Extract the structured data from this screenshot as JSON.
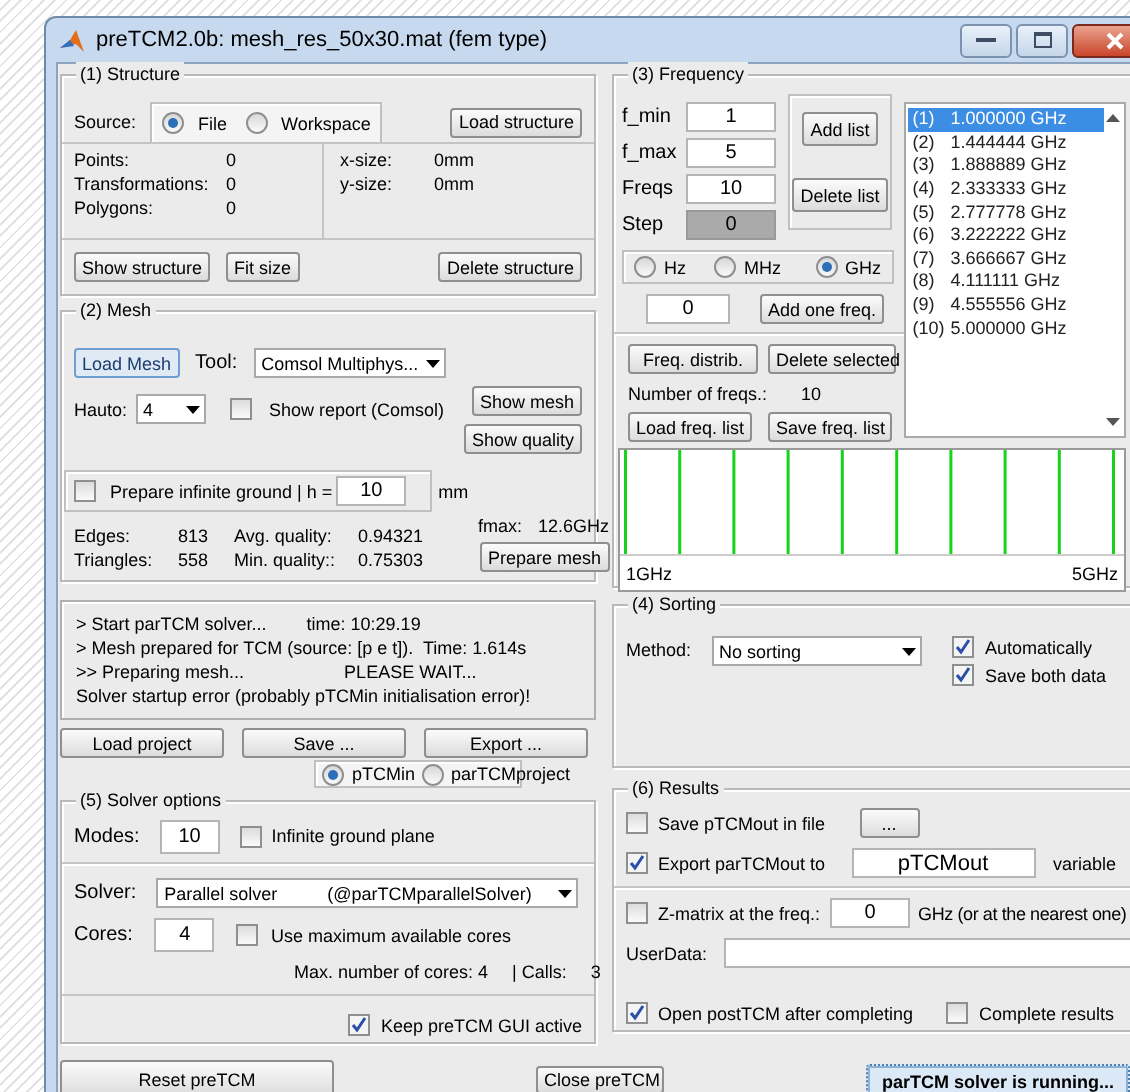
{
  "window": {
    "title": "preTCM2.0b:  mesh_res_50x30.mat (fem type)"
  },
  "structure": {
    "title": "(1) Structure",
    "source_label": "Source:",
    "source_options": [
      {
        "label": "File",
        "selected": true
      },
      {
        "label": "Workspace",
        "selected": false
      }
    ],
    "load_button": "Load structure",
    "stats": [
      {
        "label": "Points:",
        "value": "0"
      },
      {
        "label": "Transformations:",
        "value": "0"
      },
      {
        "label": "Polygons:",
        "value": "0"
      }
    ],
    "sizes": [
      {
        "label": "x-size:",
        "value": "0mm"
      },
      {
        "label": "y-size:",
        "value": "0mm"
      }
    ],
    "buttons": [
      "Show structure",
      "Fit size",
      "Delete structure"
    ]
  },
  "mesh": {
    "title": "(2) Mesh",
    "load_button": "Load Mesh",
    "tool_label": "Tool:",
    "tool_value": "Comsol Multiphys...",
    "hauto_label": "Hauto:",
    "hauto_value": "4",
    "show_report": {
      "label": "Show report (Comsol)",
      "checked": false
    },
    "show_mesh_button": "Show mesh",
    "show_quality_button": "Show quality",
    "infinite_ground": {
      "label": "Prepare infinite ground  | h =",
      "checked": false,
      "value": "10",
      "unit": "mm"
    },
    "fmax_label": "fmax:",
    "fmax_value": "12.6GHz",
    "stats": [
      {
        "label": "Edges:",
        "value": "813",
        "quality_label": "Avg. quality:",
        "quality_value": "0.94321"
      },
      {
        "label": "Triangles:",
        "value": "558",
        "quality_label": "Min. quality::",
        "quality_value": "0.75303"
      }
    ],
    "prepare_button": "Prepare mesh"
  },
  "log": [
    "> Start parTCM solver...        time: 10:29.19",
    "> Mesh prepared for TCM (source: [p e t]).  Time: 1.614s",
    ">> Preparing mesh...                    PLEASE WAIT...",
    "Solver startup error (probably pTCMin initialisation error)!"
  ],
  "project_buttons": [
    "Load project",
    "Save ...",
    "Export ..."
  ],
  "save_format": [
    {
      "label": "pTCMin",
      "selected": true
    },
    {
      "label": "parTCMproject",
      "selected": false
    }
  ],
  "solver": {
    "title": "(5) Solver options",
    "modes_label": "Modes:",
    "modes_value": "10",
    "infinite_plane": {
      "label": "Infinite ground plane",
      "checked": false
    },
    "solver_label": "Solver:",
    "solver_value": "Parallel solver          (@parTCMparallelSolver)",
    "cores_label": "Cores:",
    "cores_value": "4",
    "max_cores": {
      "label": "Use maximum available cores",
      "checked": false
    },
    "max_info": "Max. number of cores: 4",
    "calls_label": "| Calls:",
    "calls_value": "3",
    "keep_active": {
      "label": "Keep preTCM GUI active",
      "checked": true
    }
  },
  "frequency": {
    "title": "(3) Frequency",
    "fields": [
      {
        "label": "f_min",
        "value": "1",
        "disabled": false
      },
      {
        "label": "f_max",
        "value": "5",
        "disabled": false
      },
      {
        "label": "Freqs",
        "value": "10",
        "disabled": false
      },
      {
        "label": "Step",
        "value": "0",
        "disabled": true
      }
    ],
    "add_list_button": "Add list",
    "delete_list_button": "Delete list",
    "units": [
      {
        "label": "Hz",
        "selected": false
      },
      {
        "label": "MHz",
        "selected": false
      },
      {
        "label": "GHz",
        "selected": true
      }
    ],
    "one_freq_value": "0",
    "add_one_button": "Add one freq.",
    "distrib_button": "Freq. distrib.",
    "delete_selected_button": "Delete selected",
    "count_label": "Number of freqs.:",
    "count_value": "10",
    "load_list_button": "Load freq. list",
    "save_list_button": "Save freq. list",
    "list": [
      {
        "index": "(1)",
        "value": "1.000000 GHz",
        "selected": true
      },
      {
        "index": "(2)",
        "value": "1.444444 GHz",
        "selected": false
      },
      {
        "index": "(3)",
        "value": "1.888889 GHz",
        "selected": false
      },
      {
        "index": "(4)",
        "value": "2.333333 GHz",
        "selected": false
      },
      {
        "index": "(5)",
        "value": "2.777778 GHz",
        "selected": false
      },
      {
        "index": "(6)",
        "value": "3.222222 GHz",
        "selected": false
      },
      {
        "index": "(7)",
        "value": "3.666667 GHz",
        "selected": false
      },
      {
        "index": "(8)",
        "value": "4.111111 GHz",
        "selected": false
      },
      {
        "index": "(9)",
        "value": "4.555556 GHz",
        "selected": false
      },
      {
        "index": "(10)",
        "value": "5.000000 GHz",
        "selected": false
      }
    ],
    "plot_min_label": "1GHz",
    "plot_max_label": "5GHz"
  },
  "sorting": {
    "title": "(4) Sorting",
    "method_label": "Method:",
    "method_value": "No sorting",
    "options": [
      {
        "label": "Automatically",
        "checked": true
      },
      {
        "label": "Save both data",
        "checked": true
      }
    ]
  },
  "results": {
    "title": "(6) Results",
    "save_file": {
      "label": "Save pTCMout in file",
      "checked": false
    },
    "browse_button": "...",
    "export": {
      "label": "Export parTCMout to",
      "checked": true,
      "value": "pTCMout",
      "suffix": "variable"
    },
    "zmatrix": {
      "label": "Z-matrix at the freq.:",
      "checked": false,
      "value": "0",
      "suffix": "GHz (or at the nearest one)"
    },
    "userdata_label": "UserData:",
    "open_post": {
      "label": "Open postTCM after completing",
      "checked": true
    },
    "complete": {
      "label": "Complete results",
      "checked": false
    }
  },
  "footer": {
    "reset_button": "Reset preTCM",
    "close_button": "Close preTCM",
    "status_button": "parTCM solver is running..."
  }
}
